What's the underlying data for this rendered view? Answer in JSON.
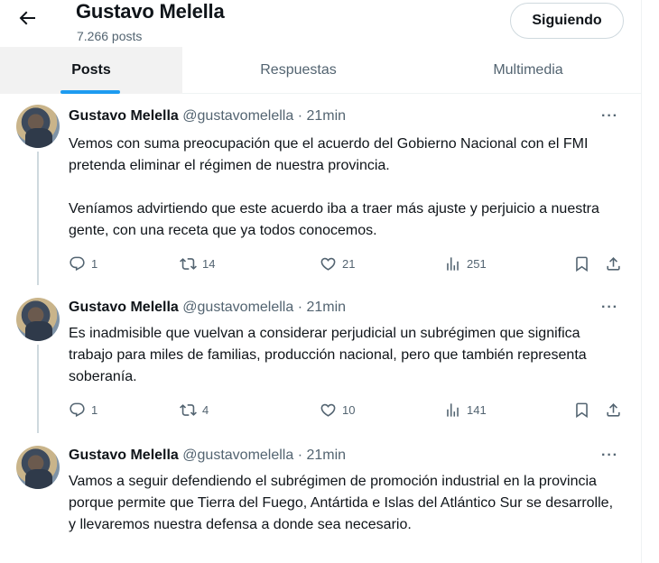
{
  "profile": {
    "name": "Gustavo Melella",
    "posts_count": "7.266 posts",
    "follow_label": "Siguiendo"
  },
  "tabs": [
    {
      "label": "Posts",
      "active": true
    },
    {
      "label": "Respuestas",
      "active": false
    },
    {
      "label": "Multimedia",
      "active": false
    }
  ],
  "tweets": [
    {
      "author": "Gustavo Melella",
      "meta": "@gustavomelella · 21min",
      "more": "···",
      "paragraphs": [
        "Vemos con suma preocupación que el acuerdo del Gobierno Nacional con el FMI pretenda eliminar el régimen de nuestra provincia.",
        "Veníamos advirtiendo que este acuerdo iba a traer más ajuste y perjuicio a nuestra gente, con una receta que ya todos conocemos."
      ],
      "replies": "1",
      "reposts": "14",
      "likes": "21",
      "views": "251"
    },
    {
      "author": "Gustavo Melella",
      "meta": "@gustavomelella · 21min",
      "more": "···",
      "paragraphs": [
        "Es inadmisible que vuelvan a considerar perjudicial un subrégimen que significa trabajo para miles de familias, producción nacional, pero que también representa soberanía."
      ],
      "replies": "1",
      "reposts": "4",
      "likes": "10",
      "views": "141"
    },
    {
      "author": "Gustavo Melella",
      "meta": "@gustavomelella · 21min",
      "more": "···",
      "paragraphs": [
        "Vamos a seguir defendiendo el subrégimen de promoción industrial en la provincia porque permite que Tierra del Fuego, Antártida e Islas del Atlántico Sur se desarrolle, y llevaremos nuestra defensa a donde sea necesario."
      ]
    }
  ],
  "icons": {
    "back": "arrow-left-icon",
    "reply": "comment-icon",
    "repost": "repost-icon",
    "like": "heart-icon",
    "views": "bar-chart-icon",
    "bookmark": "bookmark-icon",
    "share": "share-icon"
  },
  "colors": {
    "accent": "#1d9bf0",
    "text": "#0f1419",
    "muted": "#536471",
    "border": "#eff3f4",
    "active_tab_bg": "#f2f2f2"
  }
}
